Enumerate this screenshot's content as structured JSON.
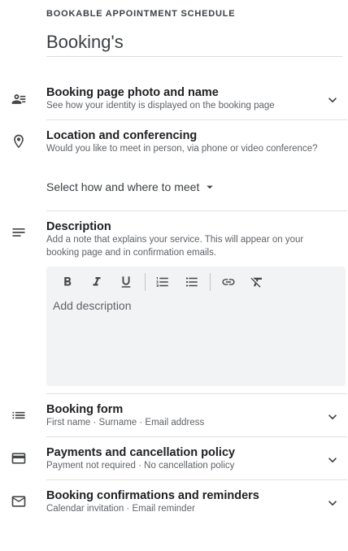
{
  "header": {
    "overline": "BOOKABLE APPOINTMENT SCHEDULE",
    "title": "Booking's"
  },
  "sections": {
    "photo": {
      "title": "Booking page photo and name",
      "subtitle": "See how your identity is displayed on the booking page",
      "icon": "contact-list-icon"
    },
    "location": {
      "title": "Location and conferencing",
      "subtitle": "Would you like to meet in person, via phone or video conference?",
      "select_label": "Select how and where to meet",
      "icon": "location-pin-icon"
    },
    "description": {
      "title": "Description",
      "subtitle_line1": "Add a note that explains your service. This will appear on your",
      "subtitle_line2": "booking page and in confirmation emails.",
      "placeholder": "Add description",
      "icon": "notes-icon",
      "toolbar": [
        "bold",
        "italic",
        "underline",
        "numbered-list",
        "bulleted-list",
        "link",
        "clear-formatting"
      ]
    },
    "form": {
      "title": "Booking form",
      "subtitle": "First name · Surname · Email address",
      "icon": "list-icon"
    },
    "payments": {
      "title": "Payments and cancellation policy",
      "subtitle": "Payment not required · No cancellation policy",
      "icon": "credit-card-icon"
    },
    "confirmations": {
      "title": "Booking confirmations and reminders",
      "subtitle": "Calendar invitation · Email reminder",
      "icon": "mail-icon"
    }
  },
  "colors": {
    "text": "#202124",
    "secondary": "#5f6368",
    "icon": "#444746",
    "divider": "#e0e0e0",
    "editor_bg": "#f1f3f4"
  }
}
